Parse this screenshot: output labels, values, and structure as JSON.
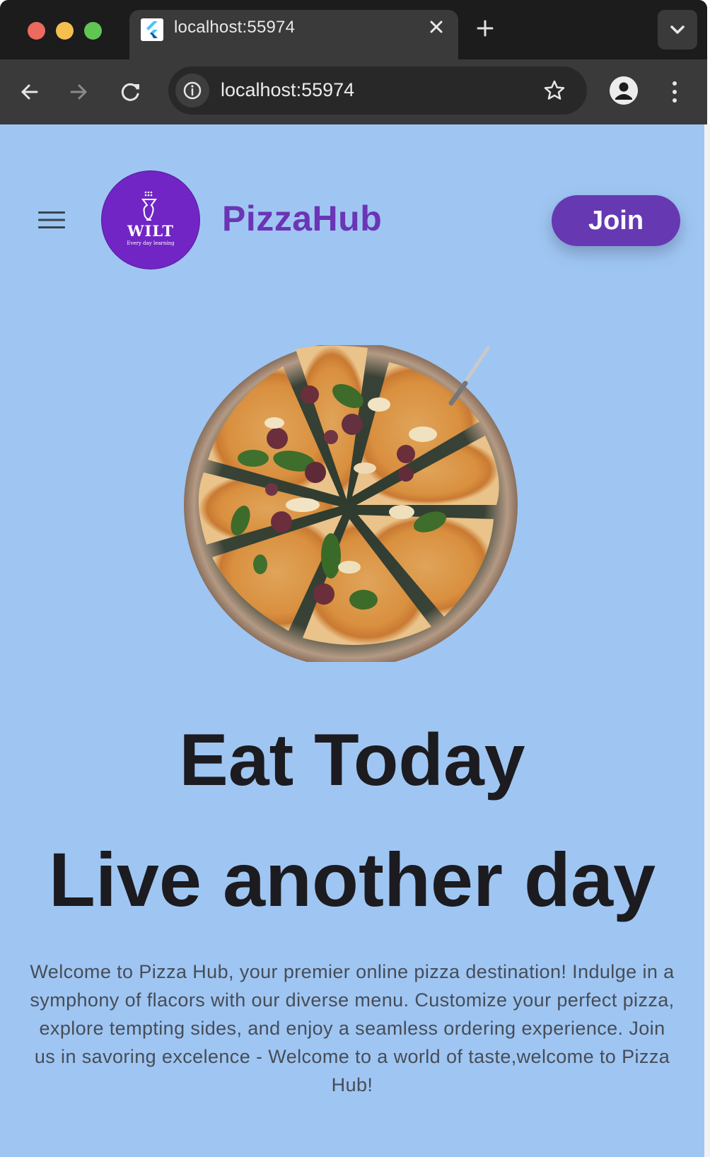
{
  "browser": {
    "tab_title": "localhost:55974",
    "url": "localhost:55974",
    "icons": {
      "back": "arrow-left-icon",
      "forward": "arrow-right-icon",
      "reload": "reload-icon",
      "site_info": "info-icon",
      "bookmark": "star-icon",
      "profile": "person-icon",
      "menu": "kebab-menu-icon",
      "new_tab": "plus-icon",
      "tab_search": "chevron-down-icon",
      "tab_close": "close-icon"
    }
  },
  "header": {
    "menu_icon": "hamburger-menu-icon",
    "logo": {
      "text": "WILT",
      "tagline": "Every day learning"
    },
    "brand": "PizzaHub",
    "join_label": "Join"
  },
  "hero": {
    "image": "pizza-image",
    "headline_1": "Eat Today",
    "headline_2": "Live another day",
    "description": "Welcome to Pizza Hub, your premier online pizza destination! Indulge in a symphony of flacors with our diverse menu. Customize your perfect pizza, explore tempting sides, and enjoy a seamless ordering experience. Join us in savoring excelence -  Welcome to a world of taste,welcome to Pizza Hub!"
  },
  "colors": {
    "page_background": "#9fc6f2",
    "brand_purple": "#6a35b6",
    "button_purple": "#6639b2",
    "logo_purple": "#7125c4",
    "headline": "#1c1b20",
    "body_text": "#474c57"
  }
}
